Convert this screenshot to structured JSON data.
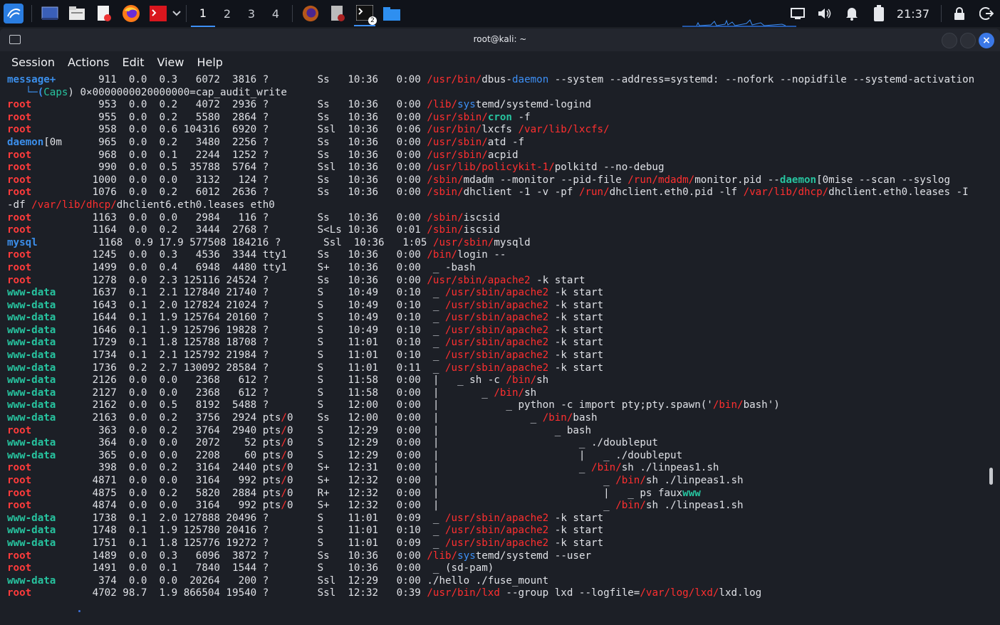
{
  "taskbar": {
    "workspaces": [
      "1",
      "2",
      "3",
      "4"
    ],
    "active_workspace": "1",
    "terminal_badge": "2",
    "clock": "21:37"
  },
  "window": {
    "title": "root@kali: ~",
    "menu": [
      "Session",
      "Actions",
      "Edit",
      "View",
      "Help"
    ]
  },
  "terminal": {
    "lines": [
      [
        [
          "message+",
          "ub"
        ],
        [
          "       911  0.0  0.3   6072  3816 ?        Ss   10:36   0:00 ",
          ""
        ],
        [
          "/usr/bin/",
          "r"
        ],
        [
          "dbus-",
          ""
        ],
        [
          "daemon",
          "hb"
        ],
        [
          " --system --address=systemd: --nofork --nopidfile --systemd-activation",
          ""
        ]
      ],
      [
        [
          "   └─(",
          "ub"
        ],
        [
          "Caps",
          "ht"
        ],
        [
          ") 0×0000000020000000=cap_audit_write",
          ""
        ]
      ],
      [
        [
          "root",
          "rb"
        ],
        [
          "           953  0.0  0.2   4072  2936 ?        Ss   10:36   0:00 ",
          ""
        ],
        [
          "/lib/",
          "r"
        ],
        [
          "sys",
          "hb"
        ],
        [
          "temd/systemd-logind",
          ""
        ]
      ],
      [
        [
          "root",
          "rb"
        ],
        [
          "           955  0.0  0.2   5580  2864 ?        Ss   10:36   0:00 ",
          ""
        ],
        [
          "/usr/sbin/",
          "r"
        ],
        [
          "cron",
          "ug"
        ],
        [
          " -f",
          ""
        ]
      ],
      [
        [
          "root",
          "rb"
        ],
        [
          "           958  0.0  0.6 104316  6920 ?        Ssl  10:36   0:06 ",
          ""
        ],
        [
          "/usr/bin/",
          "r"
        ],
        [
          "lxcfs ",
          ""
        ],
        [
          "/var/lib/lxcfs/",
          "r"
        ]
      ],
      [
        [
          "daemon",
          "ub"
        ],
        [
          "[0m      965  0.0  0.2   3480  2256 ?        Ss   10:36   0:00 ",
          ""
        ],
        [
          "/usr/sbin/",
          "r"
        ],
        [
          "atd -f",
          ""
        ]
      ],
      [
        [
          "root",
          "rb"
        ],
        [
          "           968  0.0  0.1   2244  1252 ?        Ss   10:36   0:00 ",
          ""
        ],
        [
          "/usr/sbin/",
          "r"
        ],
        [
          "acpid",
          ""
        ]
      ],
      [
        [
          "root",
          "rb"
        ],
        [
          "           990  0.0  0.5  35788  5764 ?        Ssl  10:36   0:00 ",
          ""
        ],
        [
          "/usr/lib/policykit-1/",
          "r"
        ],
        [
          "polkitd --no-debug",
          ""
        ]
      ],
      [
        [
          "root",
          "rb"
        ],
        [
          "          1000  0.0  0.0   3132   124 ?        Ss   10:36   0:00 ",
          ""
        ],
        [
          "/sbin/",
          "r"
        ],
        [
          "mdadm --monitor --pid-file ",
          ""
        ],
        [
          "/run/mdadm/",
          "r"
        ],
        [
          "monitor.pid --",
          ""
        ],
        [
          "daemon",
          "ug"
        ],
        [
          "[0mise --scan --syslog",
          ""
        ]
      ],
      [
        [
          "root",
          "rb"
        ],
        [
          "          1076  0.0  0.2   6012  2636 ?        Ss   10:36   0:00 ",
          ""
        ],
        [
          "/sbin/",
          "r"
        ],
        [
          "dhclient -1 -v -pf ",
          ""
        ],
        [
          "/run/",
          "r"
        ],
        [
          "dhclient.eth0.pid -lf ",
          ""
        ],
        [
          "/var/lib/dhcp/",
          "r"
        ],
        [
          "dhclient.eth0.leases -I",
          ""
        ]
      ],
      [
        [
          "-df ",
          ""
        ],
        [
          "/var/lib/dhcp/",
          "r"
        ],
        [
          "dhclient6.eth0.leases eth0",
          ""
        ]
      ],
      [
        [
          "root",
          "rb"
        ],
        [
          "          1163  0.0  0.0   2984   116 ?        Ss   10:36   0:00 ",
          ""
        ],
        [
          "/sbin/",
          "r"
        ],
        [
          "iscsid",
          ""
        ]
      ],
      [
        [
          "root",
          "rb"
        ],
        [
          "          1164  0.0  0.2   3444  2768 ?        S<Ls 10:36   0:01 ",
          ""
        ],
        [
          "/sbin/",
          "r"
        ],
        [
          "iscsid",
          ""
        ]
      ],
      [
        [
          "mysql",
          "ub"
        ],
        [
          "          1168  0.9 17.9 577508 184216 ?       Ssl  10:36   1:05 ",
          ""
        ],
        [
          "/usr/sbin/",
          "r"
        ],
        [
          "mysqld",
          ""
        ]
      ],
      [
        [
          "root",
          "rb"
        ],
        [
          "          1245  0.0  0.3   4536  3344 tty1     Ss   10:36   0:00 ",
          ""
        ],
        [
          "/bin/",
          "r"
        ],
        [
          "login --",
          ""
        ]
      ],
      [
        [
          "root",
          "rb"
        ],
        [
          "          1499  0.0  0.4   6948  4480 tty1     S+   10:36   0:00  _ -bash",
          ""
        ]
      ],
      [
        [
          "root",
          "rb"
        ],
        [
          "          1278  0.0  2.3 125116 24524 ?        Ss   10:36   0:00 ",
          ""
        ],
        [
          "/usr/sbin/apache2",
          "r"
        ],
        [
          " -k start",
          ""
        ]
      ],
      [
        [
          "www-data",
          "ug"
        ],
        [
          "      1637  0.1  2.1 127840 21740 ?        S    10:49   0:10  _ ",
          ""
        ],
        [
          "/usr/sbin/apache2",
          "r"
        ],
        [
          " -k start",
          ""
        ]
      ],
      [
        [
          "www-data",
          "ug"
        ],
        [
          "      1643  0.1  2.0 127824 21024 ?        S    10:49   0:10  _ ",
          ""
        ],
        [
          "/usr/sbin/apache2",
          "r"
        ],
        [
          " -k start",
          ""
        ]
      ],
      [
        [
          "www-data",
          "ug"
        ],
        [
          "      1644  0.1  1.9 125764 20160 ?        S    10:49   0:10  _ ",
          ""
        ],
        [
          "/usr/sbin/apache2",
          "r"
        ],
        [
          " -k start",
          ""
        ]
      ],
      [
        [
          "www-data",
          "ug"
        ],
        [
          "      1646  0.1  1.9 125796 19828 ?        S    10:49   0:10  _ ",
          ""
        ],
        [
          "/usr/sbin/apache2",
          "r"
        ],
        [
          " -k start",
          ""
        ]
      ],
      [
        [
          "www-data",
          "ug"
        ],
        [
          "      1729  0.1  1.8 125788 18708 ?        S    11:01   0:10  _ ",
          ""
        ],
        [
          "/usr/sbin/apache2",
          "r"
        ],
        [
          " -k start",
          ""
        ]
      ],
      [
        [
          "www-data",
          "ug"
        ],
        [
          "      1734  0.1  2.1 125792 21984 ?        S    11:01   0:10  _ ",
          ""
        ],
        [
          "/usr/sbin/apache2",
          "r"
        ],
        [
          " -k start",
          ""
        ]
      ],
      [
        [
          "www-data",
          "ug"
        ],
        [
          "      1736  0.2  2.7 130092 28584 ?        S    11:01   0:11  _ ",
          ""
        ],
        [
          "/usr/sbin/apache2",
          "r"
        ],
        [
          " -k start",
          ""
        ]
      ],
      [
        [
          "www-data",
          "ug"
        ],
        [
          "      2126  0.0  0.0   2368   612 ?        S    11:58   0:00  |   _ sh -c ",
          ""
        ],
        [
          "/bin/",
          "r"
        ],
        [
          "sh",
          ""
        ]
      ],
      [
        [
          "www-data",
          "ug"
        ],
        [
          "      2127  0.0  0.0   2368   612 ?        S    11:58   0:00  |       _ ",
          ""
        ],
        [
          "/bin/",
          "r"
        ],
        [
          "sh",
          ""
        ]
      ],
      [
        [
          "www-data",
          "ug"
        ],
        [
          "      2162  0.0  0.5   8192  5488 ?        S    12:00   0:00  |           _ python -c import pty;pty.spawn('",
          ""
        ],
        [
          "/bin/",
          "r"
        ],
        [
          "bash')",
          ""
        ]
      ],
      [
        [
          "www-data",
          "ug"
        ],
        [
          "      2163  0.0  0.2   3756  2924 pts",
          ""
        ],
        [
          "/",
          "r"
        ],
        [
          "0    Ss   12:00   0:00  |               _ ",
          ""
        ],
        [
          "/bin/",
          "r"
        ],
        [
          "bash",
          ""
        ]
      ],
      [
        [
          "root",
          "rb"
        ],
        [
          "           363  0.0  0.2   3764  2940 pts",
          ""
        ],
        [
          "/",
          "r"
        ],
        [
          "0    S    12:29   0:00  |                   _ bash",
          ""
        ]
      ],
      [
        [
          "www-data",
          "ug"
        ],
        [
          "       364  0.0  0.0   2072    52 pts",
          ""
        ],
        [
          "/",
          "r"
        ],
        [
          "0    S    12:29   0:00  |                       _ ./doubleput",
          ""
        ]
      ],
      [
        [
          "www-data",
          "ug"
        ],
        [
          "       365  0.0  0.0   2208    60 pts",
          ""
        ],
        [
          "/",
          "r"
        ],
        [
          "0    S    12:29   0:00  |                       |   _ ./doubleput",
          ""
        ]
      ],
      [
        [
          "root",
          "rb"
        ],
        [
          "           398  0.0  0.2   3164  2440 pts",
          ""
        ],
        [
          "/",
          "r"
        ],
        [
          "0    S+   12:31   0:00  |                       _ ",
          ""
        ],
        [
          "/bin/",
          "r"
        ],
        [
          "sh ./linpeas1.sh",
          ""
        ]
      ],
      [
        [
          "root",
          "rb"
        ],
        [
          "          4871  0.0  0.0   3164   992 pts",
          ""
        ],
        [
          "/",
          "r"
        ],
        [
          "0    S+   12:32   0:00  |                           _ ",
          ""
        ],
        [
          "/bin/",
          "r"
        ],
        [
          "sh ./linpeas1.sh",
          ""
        ]
      ],
      [
        [
          "root",
          "rb"
        ],
        [
          "          4875  0.0  0.2   5820  2884 pts",
          ""
        ],
        [
          "/",
          "r"
        ],
        [
          "0    R+   12:32   0:00  |                           |   _ ps faux",
          ""
        ],
        [
          "www",
          "ug"
        ]
      ],
      [
        [
          "root",
          "rb"
        ],
        [
          "          4874  0.0  0.0   3164   992 pts",
          ""
        ],
        [
          "/",
          "r"
        ],
        [
          "0    S+   12:32   0:00  |                           _ ",
          ""
        ],
        [
          "/bin/",
          "r"
        ],
        [
          "sh ./linpeas1.sh",
          ""
        ]
      ],
      [
        [
          "www-data",
          "ug"
        ],
        [
          "      1738  0.1  2.0 127888 20496 ?        S    11:01   0:09  _ ",
          ""
        ],
        [
          "/usr/sbin/apache2",
          "r"
        ],
        [
          " -k start",
          ""
        ]
      ],
      [
        [
          "www-data",
          "ug"
        ],
        [
          "      1748  0.1  1.9 125780 20416 ?        S    11:01   0:10  _ ",
          ""
        ],
        [
          "/usr/sbin/apache2",
          "r"
        ],
        [
          " -k start",
          ""
        ]
      ],
      [
        [
          "www-data",
          "ug"
        ],
        [
          "      1751  0.1  1.8 125776 19272 ?        S    11:01   0:09  _ ",
          ""
        ],
        [
          "/usr/sbin/apache2",
          "r"
        ],
        [
          " -k start",
          ""
        ]
      ],
      [
        [
          "root",
          "rb"
        ],
        [
          "          1489  0.0  0.3   6096  3872 ?        Ss   10:36   0:00 ",
          ""
        ],
        [
          "/lib/",
          "r"
        ],
        [
          "sys",
          "hb"
        ],
        [
          "temd/systemd --user",
          ""
        ]
      ],
      [
        [
          "root",
          "rb"
        ],
        [
          "          1491  0.0  0.1   7840  1544 ?        S    10:36   0:00  _ (sd-pam)",
          ""
        ]
      ],
      [
        [
          "www-data",
          "ug"
        ],
        [
          "       374  0.0  0.0  20264   200 ?        Ssl  12:29   0:00 ./hello ./fuse_mount",
          ""
        ]
      ],
      [
        [
          "root",
          "rb"
        ],
        [
          "          4702 98.7  1.9 866504 19540 ?        Ssl  12:32   0:39 ",
          ""
        ],
        [
          "/usr/bin/lxd",
          "r"
        ],
        [
          " --group lxd --logfile=",
          ""
        ],
        [
          "/var/log/lxd/",
          "r"
        ],
        [
          "lxd.log",
          ""
        ]
      ]
    ]
  }
}
